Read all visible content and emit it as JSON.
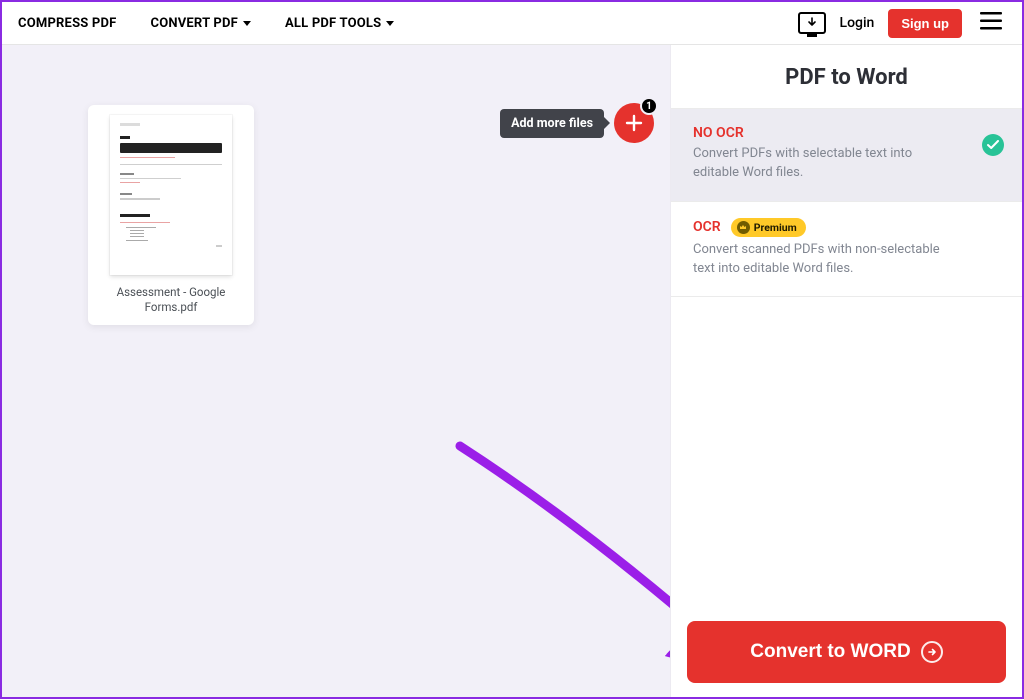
{
  "header": {
    "nav": {
      "compress": "COMPRESS PDF",
      "convert": "CONVERT PDF",
      "all_tools": "ALL PDF TOOLS"
    },
    "login": "Login",
    "signup": "Sign up"
  },
  "canvas": {
    "file_name": "Assessment - Google Forms.pdf",
    "add_more_tooltip": "Add more files",
    "badge_count": "1"
  },
  "panel": {
    "title": "PDF to Word",
    "options": {
      "no_ocr": {
        "title": "NO OCR",
        "desc": "Convert PDFs with selectable text into editable Word files."
      },
      "ocr": {
        "title": "OCR",
        "premium_label": "Premium",
        "desc": "Convert scanned PDFs with non-selectable text into editable Word files."
      }
    },
    "convert_label": "Convert to WORD"
  },
  "colors": {
    "accent": "#e5322d",
    "success": "#28c397",
    "premium": "#ffc928",
    "annotation": "#8a2be2"
  }
}
